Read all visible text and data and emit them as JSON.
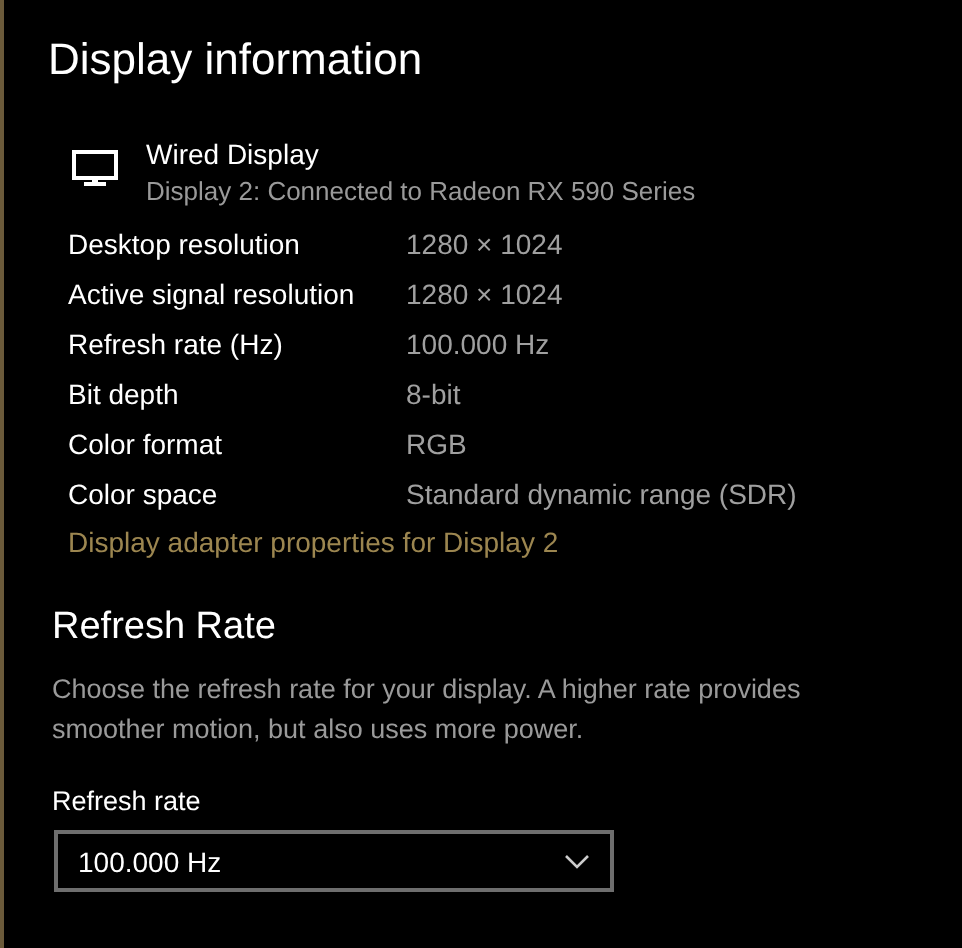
{
  "title": "Display information",
  "display": {
    "name": "Wired Display",
    "subtitle": "Display 2: Connected to Radeon RX 590 Series"
  },
  "properties": [
    {
      "label": "Desktop resolution",
      "value": "1280 × 1024"
    },
    {
      "label": "Active signal resolution",
      "value": "1280 × 1024"
    },
    {
      "label": "Refresh rate (Hz)",
      "value": "100.000 Hz"
    },
    {
      "label": "Bit depth",
      "value": "8-bit"
    },
    {
      "label": "Color format",
      "value": "RGB"
    },
    {
      "label": "Color space",
      "value": "Standard dynamic range (SDR)"
    }
  ],
  "link": "Display adapter properties for Display 2",
  "refresh_section": {
    "heading": "Refresh Rate",
    "description": "Choose the refresh rate for your display. A higher rate provides smoother motion, but also uses more power.",
    "field_label": "Refresh rate",
    "dropdown_value": "100.000 Hz"
  }
}
